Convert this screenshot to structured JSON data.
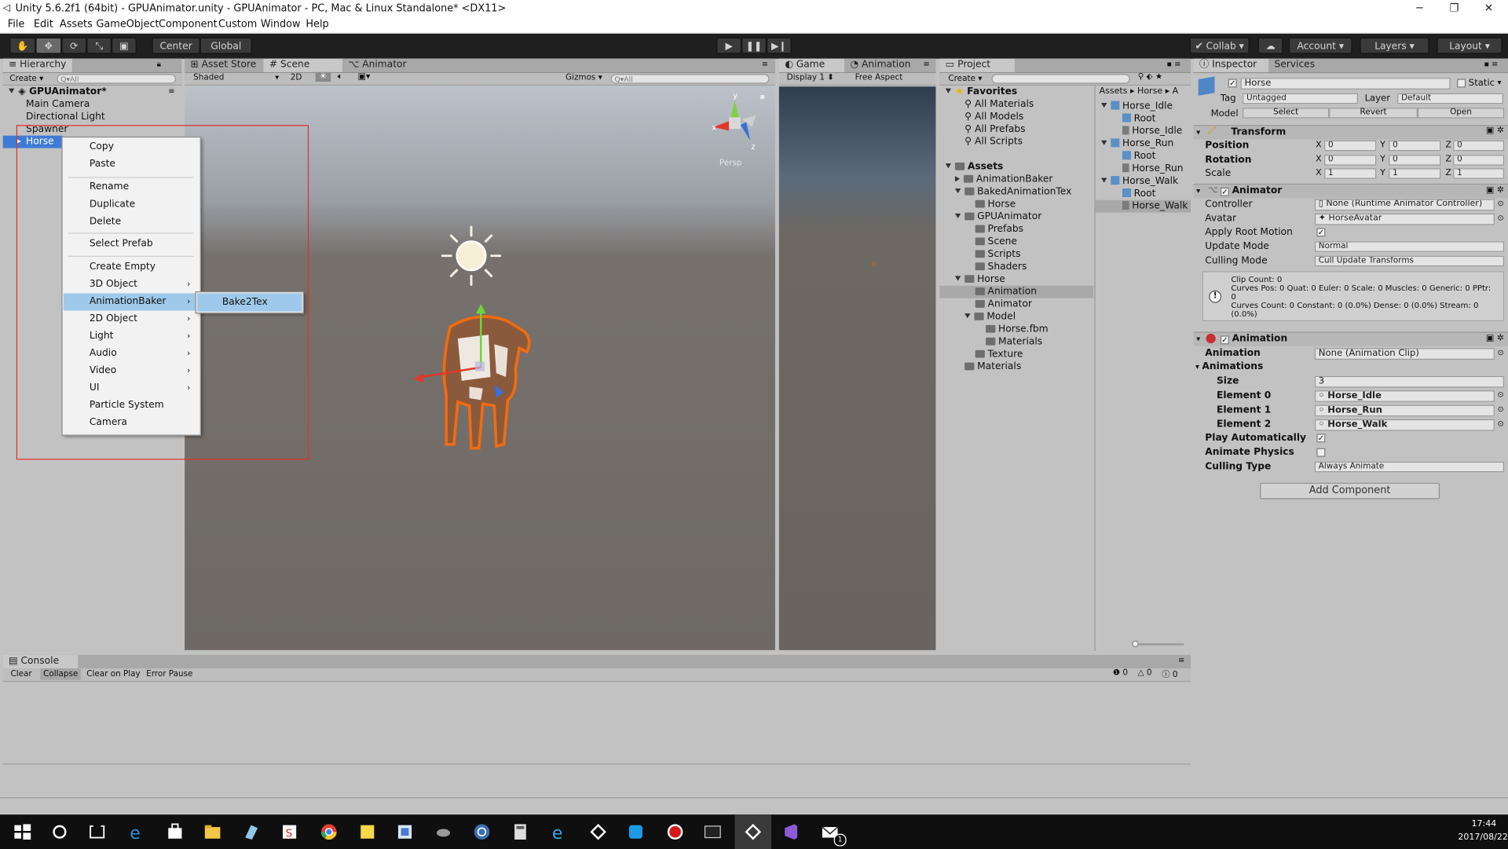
{
  "window": {
    "title": "Unity 5.6.2f1 (64bit) - GPUAnimator.unity - GPUAnimator - PC, Mac & Linux Standalone* <DX11>"
  },
  "menubar": [
    "File",
    "Edit",
    "Assets",
    "GameObject",
    "Component",
    "Custom",
    "Window",
    "Help"
  ],
  "toolbar": {
    "pivot_label": "Center",
    "space_label": "Global",
    "collab_label": "Collab",
    "account_label": "Account",
    "layers_label": "Layers",
    "layout_label": "Layout"
  },
  "hierarchy": {
    "tab": "Hierarchy",
    "create_label": "Create",
    "search_placeholder": "Q▾All",
    "scene_name": "GPUAnimator*",
    "items": [
      "Main Camera",
      "Directional Light",
      "Spawner",
      "Horse"
    ]
  },
  "scene_tabs": {
    "asset_store": "Asset Store",
    "scene": "Scene",
    "animator": "Animator",
    "shading": "Shaded",
    "mode_2d": "2D",
    "gizmos": "Gizmos",
    "search_placeholder": "Q▾All",
    "persp_label": "Persp",
    "gizmo_y": "y",
    "gizmo_x": "x",
    "gizmo_z": "z"
  },
  "game": {
    "tab": "Game",
    "animation_tab": "Animation",
    "display": "Display 1",
    "aspect": "Free Aspect"
  },
  "context_menu": {
    "items": [
      "Copy",
      "Paste",
      "Rename",
      "Duplicate",
      "Delete",
      "Select Prefab",
      "Create Empty",
      "3D Object",
      "AnimationBaker",
      "2D Object",
      "Light",
      "Audio",
      "Video",
      "UI",
      "Particle System",
      "Camera"
    ],
    "highlighted": "AnimationBaker",
    "submenu_item": "Bake2Tex",
    "colors": {
      "highlight": "#9fc9ea",
      "selection_box": "#e5302d"
    }
  },
  "project": {
    "tab": "Project",
    "create_label": "Create",
    "favorites_label": "Favorites",
    "favorites": [
      "All Materials",
      "All Models",
      "All Prefabs",
      "All Scripts"
    ],
    "assets_label": "Assets",
    "tree": [
      "AnimationBaker",
      "BakedAnimationTex",
      "Horse",
      "GPUAnimator",
      "Prefabs",
      "Scene",
      "Scripts",
      "Shaders",
      "Horse",
      "Animation",
      "Animator",
      "Model",
      "Horse.fbm",
      "Materials",
      "Texture",
      "Materials"
    ],
    "breadcrumb": [
      "Assets",
      "Horse",
      "A"
    ],
    "files": [
      "Horse_Idle",
      "Root",
      "Horse_Idle",
      "Horse_Run",
      "Root",
      "Horse_Run",
      "Horse_Walk",
      "Root",
      "Horse_Walk"
    ]
  },
  "inspector": {
    "tab": "Inspector",
    "services_tab": "Services",
    "object_name": "Horse",
    "static_label": "Static",
    "tag_label": "Tag",
    "tag_value": "Untagged",
    "layer_label": "Layer",
    "layer_value": "Default",
    "model_label": "Model",
    "model_buttons": [
      "Select",
      "Revert",
      "Open"
    ],
    "transform": {
      "title": "Transform",
      "position_label": "Position",
      "rotation_label": "Rotation",
      "scale_label": "Scale",
      "position": [
        "0",
        "0",
        "0"
      ],
      "rotation": [
        "0",
        "0",
        "0"
      ],
      "scale": [
        "1",
        "1",
        "1"
      ],
      "axis_labels": [
        "X",
        "Y",
        "Z"
      ]
    },
    "animator": {
      "title": "Animator",
      "controller_label": "Controller",
      "controller_value": "None (Runtime Animator Controller)",
      "avatar_label": "Avatar",
      "avatar_value": "HorseAvatar",
      "apply_root_motion_label": "Apply Root Motion",
      "update_mode_label": "Update Mode",
      "update_mode_value": "Normal",
      "culling_mode_label": "Culling Mode",
      "culling_mode_value": "Cull Update Transforms",
      "info_line1": "Clip Count: 0",
      "info_line2": "Curves Pos: 0 Quat: 0 Euler: 0 Scale: 0 Muscles: 0 Generic: 0 PPtr:",
      "info_line3": "0",
      "info_line4": "Curves Count: 0 Constant: 0 (0.0%) Dense: 0 (0.0%) Stream: 0",
      "info_line5": "(0.0%)"
    },
    "animation": {
      "title": "Animation",
      "animation_label": "Animation",
      "animation_value": "None (Animation Clip)",
      "animations_label": "Animations",
      "size_label": "Size",
      "size_value": "3",
      "elements": [
        {
          "label": "Element 0",
          "value": "Horse_Idle"
        },
        {
          "label": "Element 1",
          "value": "Horse_Run"
        },
        {
          "label": "Element 2",
          "value": "Horse_Walk"
        }
      ],
      "play_auto_label": "Play Automatically",
      "animate_physics_label": "Animate Physics",
      "culling_type_label": "Culling Type",
      "culling_type_value": "Always Animate"
    },
    "add_component_label": "Add Component"
  },
  "console": {
    "tab": "Console",
    "buttons": [
      "Clear",
      "Collapse",
      "Clear on Play",
      "Error Pause"
    ],
    "counts": [
      "0",
      "0",
      "0"
    ]
  },
  "taskbar": {
    "time": "17:44",
    "date": "2017/08/22",
    "mail_badge": "1"
  }
}
